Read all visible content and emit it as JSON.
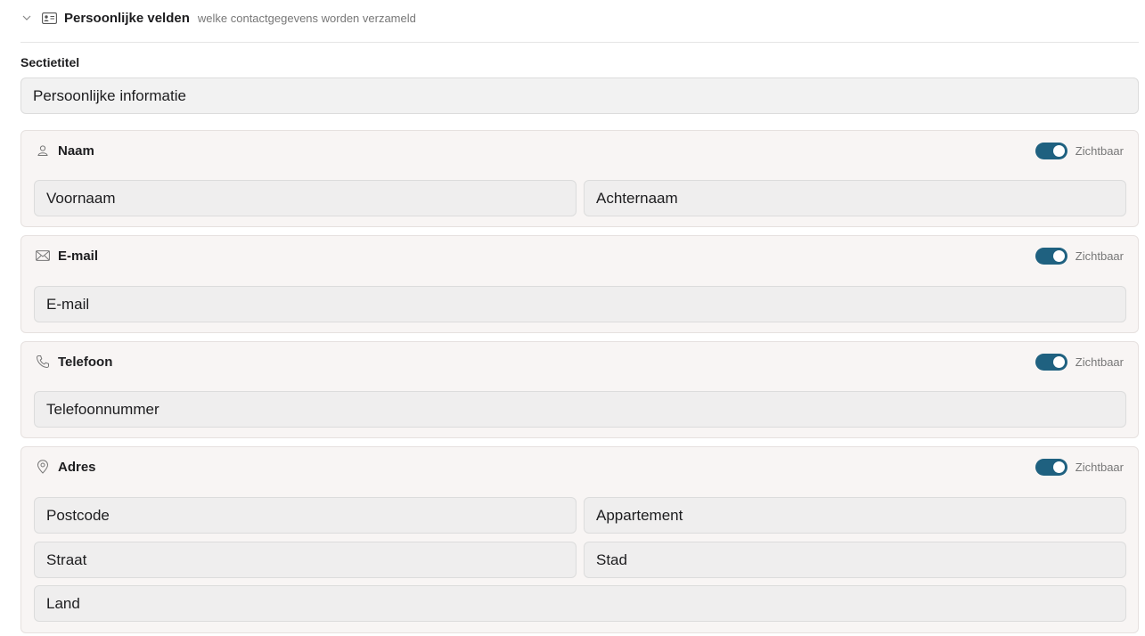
{
  "header": {
    "title": "Persoonlijke velden",
    "subtitle": "welke contactgegevens worden verzameld"
  },
  "section": {
    "label": "Sectietitel",
    "value": "Persoonlijke informatie"
  },
  "cards": {
    "naam": {
      "title": "Naam",
      "toggle_label": "Zichtbaar",
      "fields": [
        "Voornaam",
        "Achternaam"
      ]
    },
    "email": {
      "title": "E-mail",
      "toggle_label": "Zichtbaar",
      "fields": [
        "E-mail"
      ]
    },
    "telefoon": {
      "title": "Telefoon",
      "toggle_label": "Zichtbaar",
      "fields": [
        "Telefoonnummer"
      ]
    },
    "adres": {
      "title": "Adres",
      "toggle_label": "Zichtbaar",
      "fields": [
        "Postcode",
        "Appartement",
        "Straat",
        "Stad",
        "Land"
      ]
    }
  },
  "colors": {
    "toggle_on": "#1f6180",
    "card_bg": "#f8f5f4",
    "field_bg": "#efeeee"
  },
  "icons": {
    "collapse": "chevron-down-icon",
    "header": "id-card-icon",
    "naam": "user-icon",
    "email": "mail-icon",
    "telefoon": "phone-icon",
    "adres": "map-pin-icon"
  }
}
